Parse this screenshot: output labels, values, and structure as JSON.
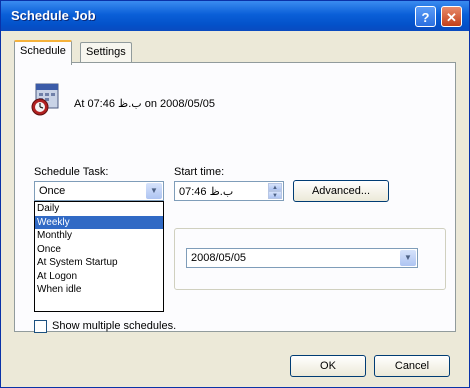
{
  "window": {
    "title": "Schedule Job",
    "help_glyph": "?",
    "close_glyph": "✕"
  },
  "tabs": [
    {
      "label": "Schedule",
      "active": true
    },
    {
      "label": "Settings",
      "active": false
    }
  ],
  "summary": {
    "text": "At 07:46 ب.ظ on 2008/05/05"
  },
  "schedule_task": {
    "label": "Schedule Task:",
    "value": "Once",
    "options": [
      "Daily",
      "Weekly",
      "Monthly",
      "Once",
      "At System Startup",
      "At Logon",
      "When idle"
    ],
    "highlighted": "Weekly"
  },
  "start_time": {
    "label": "Start time:",
    "value": "07:46 ب.ظ"
  },
  "advanced_button": "Advanced...",
  "date_field": {
    "value": "2008/05/05"
  },
  "show_multiple": {
    "label": "Show multiple schedules.",
    "checked": false
  },
  "buttons": {
    "ok": "OK",
    "cancel": "Cancel"
  },
  "colors": {
    "titlebar": "#0a5fd8",
    "selection": "#316ac5",
    "tab_accent": "#f5b23c"
  }
}
